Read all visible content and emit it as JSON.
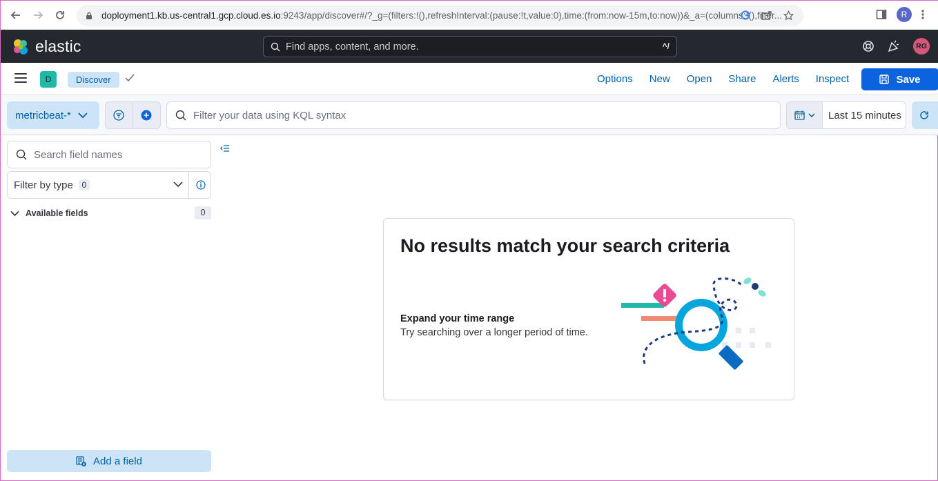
{
  "browser": {
    "url_host": "doployment1.kb.us-central1.gcp.cloud.es.io",
    "url_rest": ":9243/app/discover#/?_g=(filters:!(),refreshInterval:(pause:!t,value:0),time:(from:now-15m,to:now))&_a=(columns:!(),filter...",
    "profile_initial": "R"
  },
  "header": {
    "logo_text": "elastic",
    "search_placeholder": "Find apps, content, and more.",
    "search_shortcut": "^/",
    "avatar_initials": "RG"
  },
  "app_bar": {
    "space_initial": "D",
    "breadcrumb": "Discover",
    "links": [
      "Options",
      "New",
      "Open",
      "Share",
      "Alerts",
      "Inspect"
    ],
    "save_label": "Save"
  },
  "query_bar": {
    "data_view": "metricbeat-*",
    "kql_placeholder": "Filter your data using KQL syntax",
    "time_range": "Last 15 minutes"
  },
  "sidebar": {
    "search_placeholder": "Search field names",
    "filter_type_label": "Filter by type",
    "filter_type_count": "0",
    "available_fields_label": "Available fields",
    "available_fields_count": "0",
    "add_field_label": "Add a field"
  },
  "empty_state": {
    "title": "No results match your search criteria",
    "subtitle": "Expand your time range",
    "text": "Try searching over a longer period of time."
  },
  "colors": {
    "header_bg": "#25282f",
    "primary": "#0b64dd",
    "link": "#0061a6",
    "light_blue": "#cce4f5",
    "space_badge": "#20b8a8"
  }
}
